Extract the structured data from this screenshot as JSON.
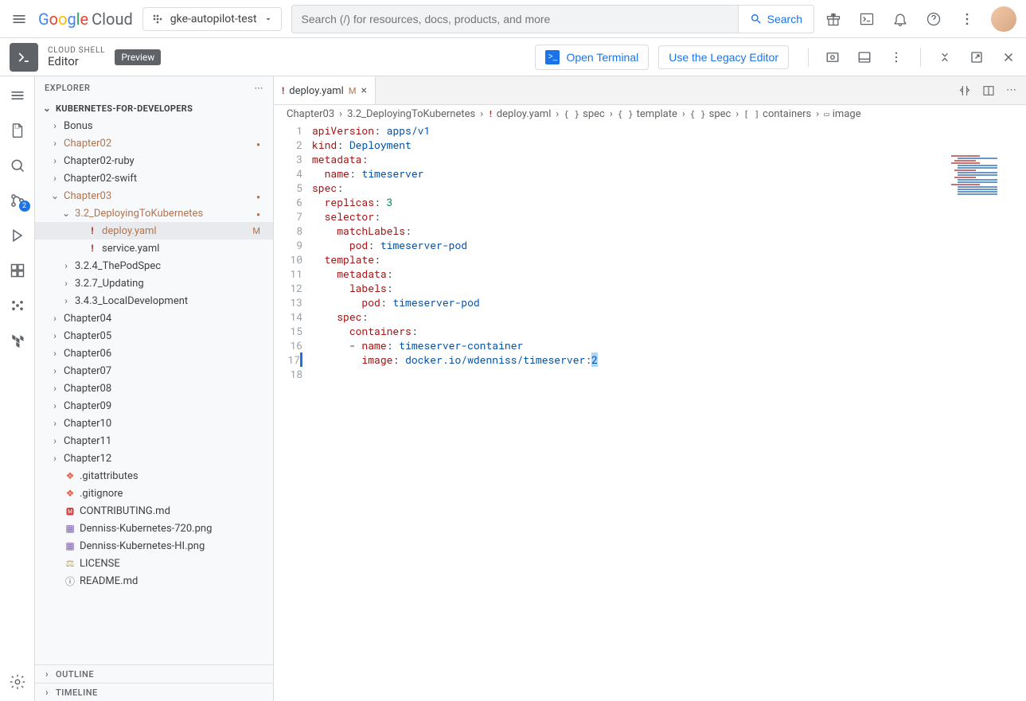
{
  "header": {
    "logo_cloud": "Cloud",
    "project": "gke-autopilot-test",
    "search_placeholder": "Search (/) for resources, docs, products, and more",
    "search_button": "Search"
  },
  "ribbon": {
    "label_top": "CLOUD SHELL",
    "label_bottom": "Editor",
    "preview": "Preview",
    "open_terminal": "Open Terminal",
    "legacy": "Use the Legacy Editor"
  },
  "activity": {
    "scm_count": "2"
  },
  "sidebar": {
    "title": "EXPLORER",
    "root": "KUBERNETES-FOR-DEVELOPERS",
    "outline": "OUTLINE",
    "timeline": "TIMELINE",
    "tree": [
      {
        "label": "Bonus",
        "indent": 1,
        "chev": "right"
      },
      {
        "label": "Chapter02",
        "indent": 1,
        "chev": "right",
        "mod": true,
        "dot": true
      },
      {
        "label": "Chapter02-ruby",
        "indent": 1,
        "chev": "right"
      },
      {
        "label": "Chapter02-swift",
        "indent": 1,
        "chev": "right"
      },
      {
        "label": "Chapter03",
        "indent": 1,
        "chev": "down",
        "mod": true,
        "dot": true
      },
      {
        "label": "3.2_DeployingToKubernetes",
        "indent": 2,
        "chev": "down",
        "mod": true,
        "dot": true
      },
      {
        "label": "deploy.yaml",
        "indent": 3,
        "icon": "yaml",
        "mod": true,
        "status": "M",
        "selected": true
      },
      {
        "label": "service.yaml",
        "indent": 3,
        "icon": "yaml"
      },
      {
        "label": "3.2.4_ThePodSpec",
        "indent": 2,
        "chev": "right"
      },
      {
        "label": "3.2.7_Updating",
        "indent": 2,
        "chev": "right"
      },
      {
        "label": "3.4.3_LocalDevelopment",
        "indent": 2,
        "chev": "right"
      },
      {
        "label": "Chapter04",
        "indent": 1,
        "chev": "right"
      },
      {
        "label": "Chapter05",
        "indent": 1,
        "chev": "right"
      },
      {
        "label": "Chapter06",
        "indent": 1,
        "chev": "right"
      },
      {
        "label": "Chapter07",
        "indent": 1,
        "chev": "right"
      },
      {
        "label": "Chapter08",
        "indent": 1,
        "chev": "right"
      },
      {
        "label": "Chapter09",
        "indent": 1,
        "chev": "right"
      },
      {
        "label": "Chapter10",
        "indent": 1,
        "chev": "right"
      },
      {
        "label": "Chapter11",
        "indent": 1,
        "chev": "right"
      },
      {
        "label": "Chapter12",
        "indent": 1,
        "chev": "right"
      },
      {
        "label": ".gitattributes",
        "indent": 1,
        "icon": "git"
      },
      {
        "label": ".gitignore",
        "indent": 1,
        "icon": "git"
      },
      {
        "label": "CONTRIBUTING.md",
        "indent": 1,
        "icon": "md"
      },
      {
        "label": "Denniss-Kubernetes-720.png",
        "indent": 1,
        "icon": "img"
      },
      {
        "label": "Denniss-Kubernetes-HI.png",
        "indent": 1,
        "icon": "img"
      },
      {
        "label": "LICENSE",
        "indent": 1,
        "icon": "lic"
      },
      {
        "label": "README.md",
        "indent": 1,
        "icon": "info"
      }
    ]
  },
  "tab": {
    "name": "deploy.yaml",
    "status": "M"
  },
  "breadcrumbs": [
    {
      "label": "Chapter03"
    },
    {
      "label": "3.2_DeployingToKubernetes"
    },
    {
      "label": "deploy.yaml",
      "icon": "!"
    },
    {
      "label": "spec",
      "icon": "{}"
    },
    {
      "label": "template",
      "icon": "{}"
    },
    {
      "label": "spec",
      "icon": "{}"
    },
    {
      "label": "containers",
      "icon": "[]"
    },
    {
      "label": "image",
      "icon": "▭"
    }
  ],
  "code": {
    "lines": [
      {
        "n": "1",
        "tokens": [
          [
            "apiVersion",
            "key"
          ],
          [
            ":",
            "punc"
          ],
          [
            " ",
            "p"
          ],
          [
            "apps/v1",
            "str"
          ]
        ]
      },
      {
        "n": "2",
        "tokens": [
          [
            "kind",
            "key"
          ],
          [
            ":",
            "punc"
          ],
          [
            " ",
            "p"
          ],
          [
            "Deployment",
            "str"
          ]
        ]
      },
      {
        "n": "3",
        "tokens": [
          [
            "metadata",
            "key"
          ],
          [
            ":",
            "punc"
          ]
        ]
      },
      {
        "n": "4",
        "tokens": [
          [
            "  ",
            "p"
          ],
          [
            "name",
            "key"
          ],
          [
            ":",
            "punc"
          ],
          [
            " ",
            "p"
          ],
          [
            "timeserver",
            "str"
          ]
        ]
      },
      {
        "n": "5",
        "tokens": [
          [
            "spec",
            "key"
          ],
          [
            ":",
            "punc"
          ]
        ]
      },
      {
        "n": "6",
        "tokens": [
          [
            "  ",
            "p"
          ],
          [
            "replicas",
            "key"
          ],
          [
            ":",
            "punc"
          ],
          [
            " ",
            "p"
          ],
          [
            "3",
            "num"
          ]
        ]
      },
      {
        "n": "7",
        "tokens": [
          [
            "  ",
            "p"
          ],
          [
            "selector",
            "key"
          ],
          [
            ":",
            "punc"
          ]
        ]
      },
      {
        "n": "8",
        "tokens": [
          [
            "    ",
            "p"
          ],
          [
            "matchLabels",
            "key"
          ],
          [
            ":",
            "punc"
          ]
        ]
      },
      {
        "n": "9",
        "tokens": [
          [
            "      ",
            "p"
          ],
          [
            "pod",
            "key"
          ],
          [
            ":",
            "punc"
          ],
          [
            " ",
            "p"
          ],
          [
            "timeserver-pod",
            "str"
          ]
        ]
      },
      {
        "n": "10",
        "tokens": [
          [
            "  ",
            "p"
          ],
          [
            "template",
            "key"
          ],
          [
            ":",
            "punc"
          ]
        ]
      },
      {
        "n": "11",
        "tokens": [
          [
            "    ",
            "p"
          ],
          [
            "metadata",
            "key"
          ],
          [
            ":",
            "punc"
          ]
        ]
      },
      {
        "n": "12",
        "tokens": [
          [
            "      ",
            "p"
          ],
          [
            "labels",
            "key"
          ],
          [
            ":",
            "punc"
          ]
        ]
      },
      {
        "n": "13",
        "tokens": [
          [
            "        ",
            "p"
          ],
          [
            "pod",
            "key"
          ],
          [
            ":",
            "punc"
          ],
          [
            " ",
            "p"
          ],
          [
            "timeserver-pod",
            "str"
          ]
        ]
      },
      {
        "n": "14",
        "tokens": [
          [
            "    ",
            "p"
          ],
          [
            "spec",
            "key"
          ],
          [
            ":",
            "punc"
          ]
        ]
      },
      {
        "n": "15",
        "tokens": [
          [
            "      ",
            "p"
          ],
          [
            "containers",
            "key"
          ],
          [
            ":",
            "punc"
          ]
        ]
      },
      {
        "n": "16",
        "tokens": [
          [
            "      - ",
            "p"
          ],
          [
            "name",
            "key"
          ],
          [
            ":",
            "punc"
          ],
          [
            " ",
            "p"
          ],
          [
            "timeserver-container",
            "str"
          ]
        ]
      },
      {
        "n": "17",
        "mod": true,
        "tokens": [
          [
            "        ",
            "p"
          ],
          [
            "image",
            "key"
          ],
          [
            ":",
            "punc"
          ],
          [
            " ",
            "p"
          ],
          [
            "docker.io/wdenniss/timeserver:",
            "str"
          ],
          [
            "2",
            "str-sel"
          ]
        ]
      },
      {
        "n": "18",
        "tokens": []
      }
    ]
  }
}
